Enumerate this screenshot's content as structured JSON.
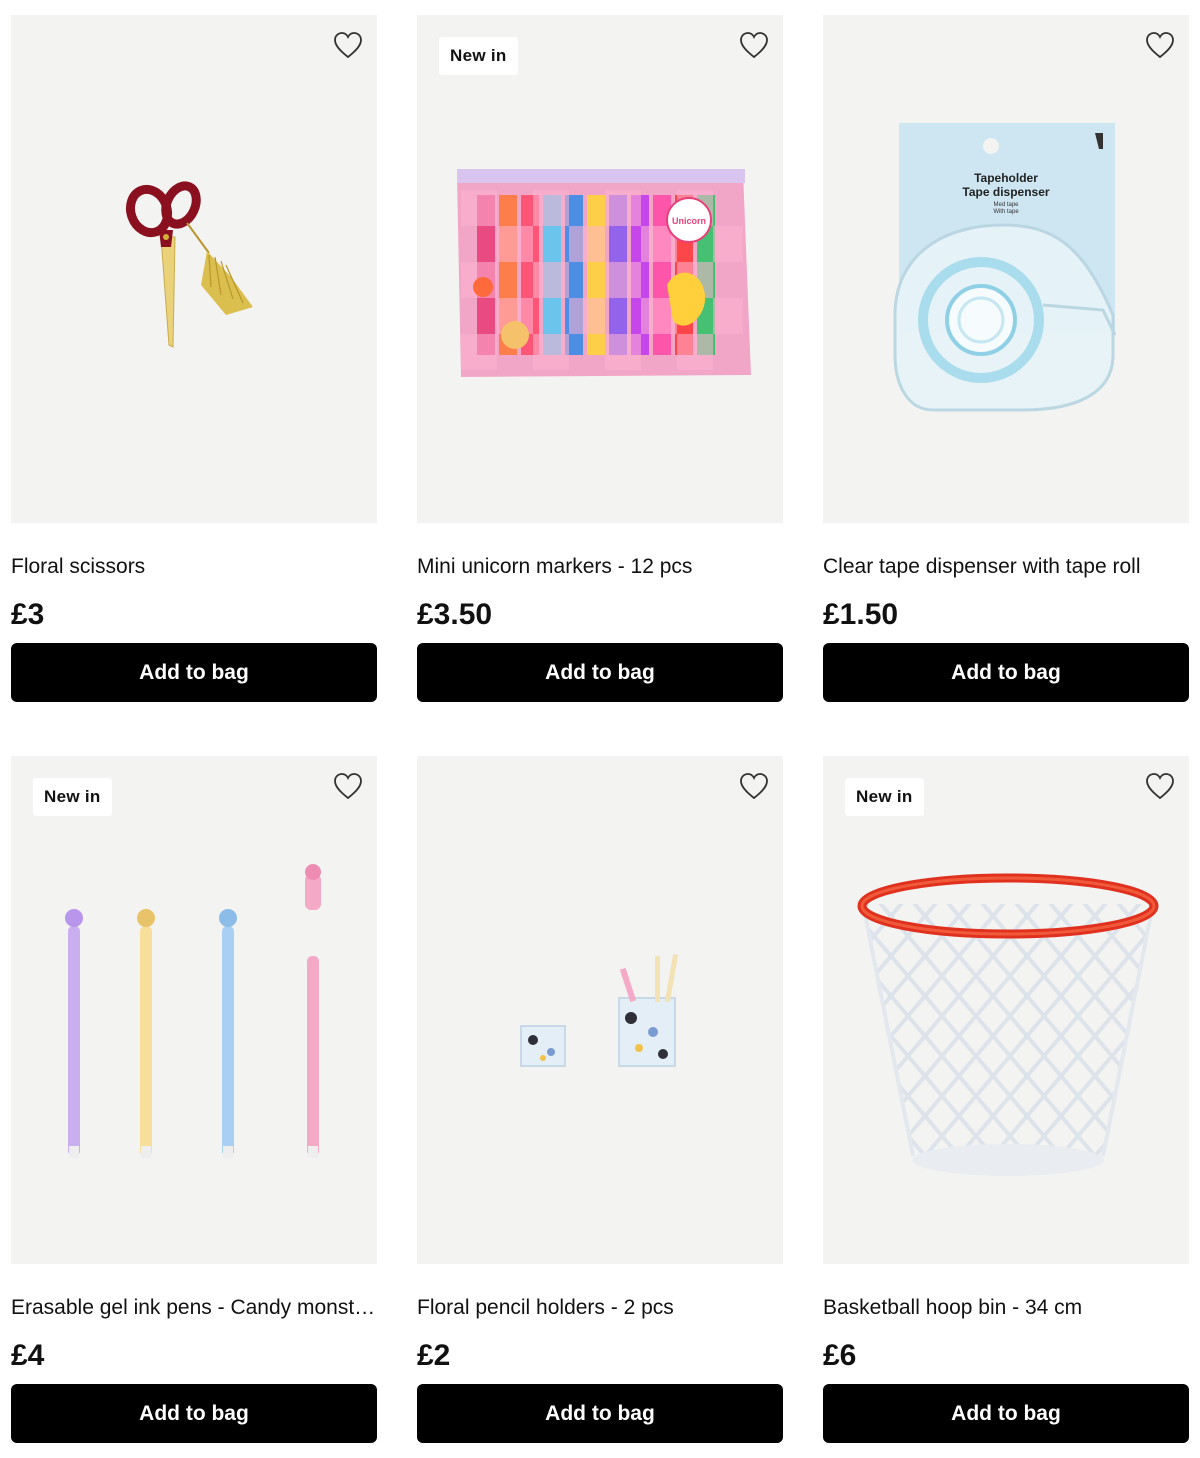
{
  "products": [
    {
      "title": "Floral scissors",
      "price": "£3",
      "badge": "",
      "button_label": "Add to bag",
      "image": "scissors"
    },
    {
      "title": "Mini unicorn markers - 12 pcs",
      "price": "£3.50",
      "badge": "New in",
      "button_label": "Add to bag",
      "image": "markers-pouch",
      "image_text": "Unicorn"
    },
    {
      "title": "Clear tape dispenser with tape roll",
      "price": "£1.50",
      "badge": "",
      "button_label": "Add to bag",
      "image": "tape-dispenser",
      "image_text": {
        "line1": "Tapeholder",
        "line2": "Tape dispenser",
        "line3": "Med tape",
        "line4": "With tape"
      }
    },
    {
      "title": "Erasable gel ink pens - Candy monst…",
      "price": "£4",
      "badge": "New in",
      "button_label": "Add to bag",
      "image": "gel-pens"
    },
    {
      "title": "Floral pencil holders - 2 pcs",
      "price": "£2",
      "badge": "",
      "button_label": "Add to bag",
      "image": "pencil-holders"
    },
    {
      "title": "Basketball hoop bin - 34 cm",
      "price": "£6",
      "badge": "New in",
      "button_label": "Add to bag",
      "image": "basketball-bin"
    }
  ],
  "colors": {
    "button_bg": "#000000",
    "image_bg": "#f3f3f2",
    "badge_bg": "#ffffff"
  },
  "icons": {
    "favorite": "heart-outline-icon"
  }
}
